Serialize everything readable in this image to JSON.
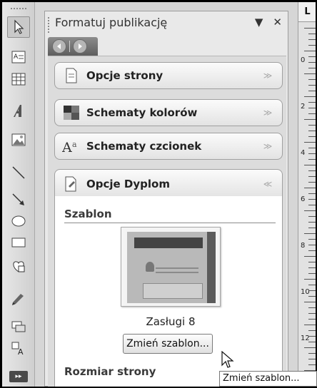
{
  "task_pane": {
    "title": "Formatuj publikację",
    "dropdown_glyph": "▼",
    "close_glyph": "✕",
    "nav": {
      "back_icon": "back-arrow-icon",
      "forward_icon": "forward-arrow-icon"
    },
    "sections": [
      {
        "label": "Opcje strony",
        "icon": "page-options-icon",
        "state": "collapsed"
      },
      {
        "label": "Schematy kolorów",
        "icon": "color-scheme-icon",
        "state": "collapsed"
      },
      {
        "label": "Schematy czcionek",
        "icon": "font-scheme-icon",
        "state": "collapsed"
      },
      {
        "label": "Opcje Dyplom",
        "icon": "certificate-options-icon",
        "state": "expanded"
      }
    ],
    "template_heading": "Szablon",
    "template_name": "Zasługi  8",
    "change_template_button": "Zmień szablon...",
    "page_size_heading": "Rozmiar strony"
  },
  "tooltip": "Zmień szablon...",
  "ruler": {
    "corner": "L",
    "labels": [
      "0",
      "2",
      "4",
      "6",
      "8",
      "10",
      "12"
    ]
  },
  "toolbar_more": "▸▸",
  "colors": {
    "pane_bg": "#e9e9e9",
    "section_border": "#a0a0a0",
    "nav_bar": "#6e6e6e"
  }
}
